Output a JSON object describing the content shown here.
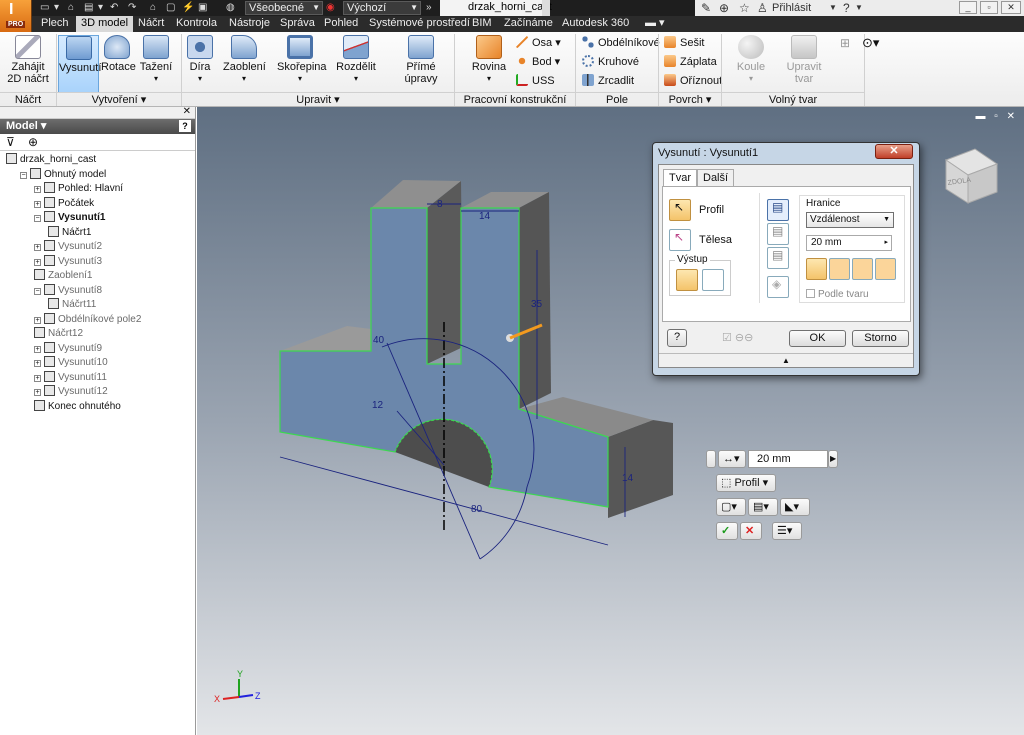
{
  "app": {
    "logo_letter": "I",
    "edition_badge": "PRO"
  },
  "titlebar": {
    "style_combo": "Všeobecné",
    "appearance_combo": "Výchozí",
    "document_tab": "drzak_horni_cast",
    "login": "Přihlásit"
  },
  "ribbon_tabs": [
    "Plech",
    "3D model",
    "Náčrt",
    "Kontrola",
    "Nástroje",
    "Správa",
    "Pohled",
    "Systémové prostředí",
    "BIM",
    "Začínáme",
    "Autodesk 360"
  ],
  "active_tab": "3D model",
  "ribbon": {
    "sketch": {
      "start_2d_sketch": [
        "Zahájit",
        "2D náčrt"
      ],
      "group": "Náčrt"
    },
    "create": {
      "extrude": "Vysunutí",
      "revolve": "Rotace",
      "sweep": "Tažení",
      "group": "Vytvoření"
    },
    "modify": {
      "hole": "Díra",
      "fillet": "Zaoblení",
      "shell": "Skořepina",
      "split": "Rozdělit",
      "direct_edit": "Přímé úpravy",
      "group": "Upravit"
    },
    "work_features": {
      "plane": "Rovina",
      "axis": "Osa",
      "point": "Bod",
      "ucs": "USS",
      "group": "Pracovní konstrukční prvky"
    },
    "pattern": {
      "rectangular": "Obdélníkové",
      "circular": "Kruhové",
      "mirror": "Zrcadlit",
      "group": "Pole"
    },
    "surface": {
      "stitch": "Sešit",
      "patch": "Záplata",
      "trim": "Oříznout",
      "group": "Povrch"
    },
    "freeform": {
      "sphere": "Koule",
      "edit_form": [
        "Upravit",
        "tvar"
      ],
      "group": "Volný tvar"
    }
  },
  "browser": {
    "title": "Model",
    "items": [
      {
        "label": "drzak_horni_cast",
        "indent": 0,
        "expander": "",
        "active": false,
        "dimmed": false
      },
      {
        "label": "Ohnutý model",
        "indent": 1,
        "expander": "−",
        "active": false,
        "dimmed": false
      },
      {
        "label": "Pohled: Hlavní",
        "indent": 2,
        "expander": "+",
        "active": false,
        "dimmed": false
      },
      {
        "label": "Počátek",
        "indent": 2,
        "expander": "+",
        "active": false,
        "dimmed": false
      },
      {
        "label": "Vysunutí1",
        "indent": 2,
        "expander": "−",
        "active": true,
        "dimmed": false
      },
      {
        "label": "Náčrt1",
        "indent": 3,
        "expander": "",
        "active": false,
        "dimmed": false
      },
      {
        "label": "Vysunutí2",
        "indent": 2,
        "expander": "+",
        "active": false,
        "dimmed": true
      },
      {
        "label": "Vysunutí3",
        "indent": 2,
        "expander": "+",
        "active": false,
        "dimmed": true
      },
      {
        "label": "Zaoblení1",
        "indent": 2,
        "expander": "",
        "active": false,
        "dimmed": true
      },
      {
        "label": "Vysunutí8",
        "indent": 2,
        "expander": "−",
        "active": false,
        "dimmed": true
      },
      {
        "label": "Náčrt11",
        "indent": 3,
        "expander": "",
        "active": false,
        "dimmed": true
      },
      {
        "label": "Obdélníkové pole2",
        "indent": 2,
        "expander": "+",
        "active": false,
        "dimmed": true
      },
      {
        "label": "Náčrt12",
        "indent": 2,
        "expander": "",
        "active": false,
        "dimmed": true
      },
      {
        "label": "Vysunutí9",
        "indent": 2,
        "expander": "+",
        "active": false,
        "dimmed": true
      },
      {
        "label": "Vysunutí10",
        "indent": 2,
        "expander": "+",
        "active": false,
        "dimmed": true
      },
      {
        "label": "Vysunutí11",
        "indent": 2,
        "expander": "+",
        "active": false,
        "dimmed": true
      },
      {
        "label": "Vysunutí12",
        "indent": 2,
        "expander": "+",
        "active": false,
        "dimmed": true
      },
      {
        "label": "Konec ohnutého",
        "indent": 2,
        "expander": "",
        "active": false,
        "dimmed": false
      }
    ]
  },
  "viewport": {
    "viewcube_label": "ZDOLA",
    "dimensions": {
      "d8": "8",
      "d14_top": "14",
      "d35": "35",
      "d40": "40",
      "d12": "12",
      "d80": "80",
      "d14_right": "14"
    },
    "triad": {
      "x": "X",
      "y": "Y",
      "z": "Z"
    },
    "mini_toolbar": {
      "distance": "20 mm",
      "profile": "Profil"
    }
  },
  "dialog": {
    "title": "Vysunutí : Vysunutí1",
    "tabs": [
      "Tvar",
      "Další"
    ],
    "profile_label": "Profil",
    "bodies_label": "Tělesa",
    "output_label": "Výstup",
    "extents_label": "Hranice",
    "extents_value": "Vzdálenost",
    "distance_value": "20 mm",
    "match_shape_label": "Podle tvaru",
    "ok": "OK",
    "cancel": "Storno"
  },
  "colors": {
    "face": "#6b87ab",
    "edge": "#3cd850",
    "dim": "#1a237e",
    "accent": "#f39a1f"
  }
}
